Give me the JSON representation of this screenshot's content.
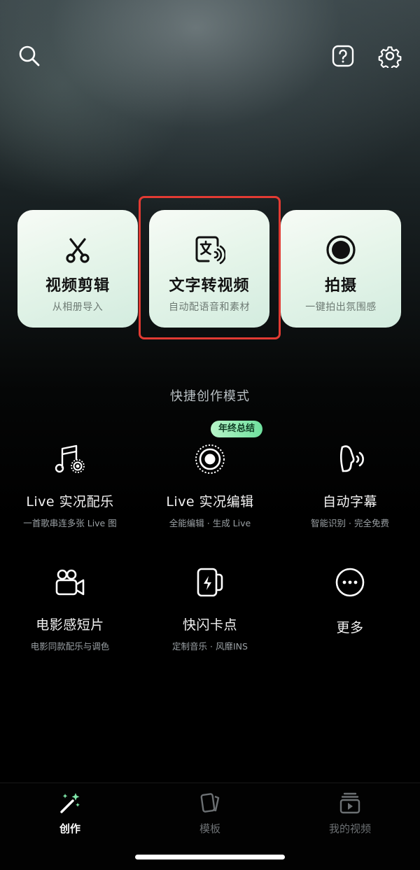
{
  "top_bar": {
    "search_icon": "search-icon",
    "help_icon": "help-icon",
    "settings_icon": "gear-icon"
  },
  "cards": [
    {
      "title": "视频剪辑",
      "subtitle": "从相册导入",
      "icon": "scissors-icon"
    },
    {
      "title": "文字转视频",
      "subtitle": "自动配语音和素材",
      "icon": "text-to-video-icon"
    },
    {
      "title": "拍摄",
      "subtitle": "一键拍出氛围感",
      "icon": "shutter-icon"
    }
  ],
  "section_title": "快捷创作模式",
  "badge": "年终总结",
  "modes": [
    {
      "title": "Live 实况配乐",
      "subtitle": "一首歌串连多张 Live 图",
      "icon": "music-note-icon"
    },
    {
      "title": "Live 实况编辑",
      "subtitle": "全能编辑 · 生成 Live",
      "icon": "live-photo-icon"
    },
    {
      "title": "自动字幕",
      "subtitle": "智能识别 · 完全免费",
      "icon": "speaking-head-icon"
    },
    {
      "title": "电影感短片",
      "subtitle": "电影同款配乐与调色",
      "icon": "movie-camera-icon"
    },
    {
      "title": "快闪卡点",
      "subtitle": "定制音乐 · 风靡INS",
      "icon": "flash-card-icon"
    },
    {
      "title": "更多",
      "subtitle": "",
      "icon": "more-icon"
    }
  ],
  "tabs": [
    {
      "label": "创作",
      "icon": "magic-wand-icon",
      "active": true
    },
    {
      "label": "模板",
      "icon": "template-cards-icon",
      "active": false
    },
    {
      "label": "我的视频",
      "icon": "my-videos-icon",
      "active": false
    }
  ],
  "colors": {
    "highlight": "#e23b33",
    "badge": "#6fe09e",
    "card": "#e6f5ea"
  }
}
